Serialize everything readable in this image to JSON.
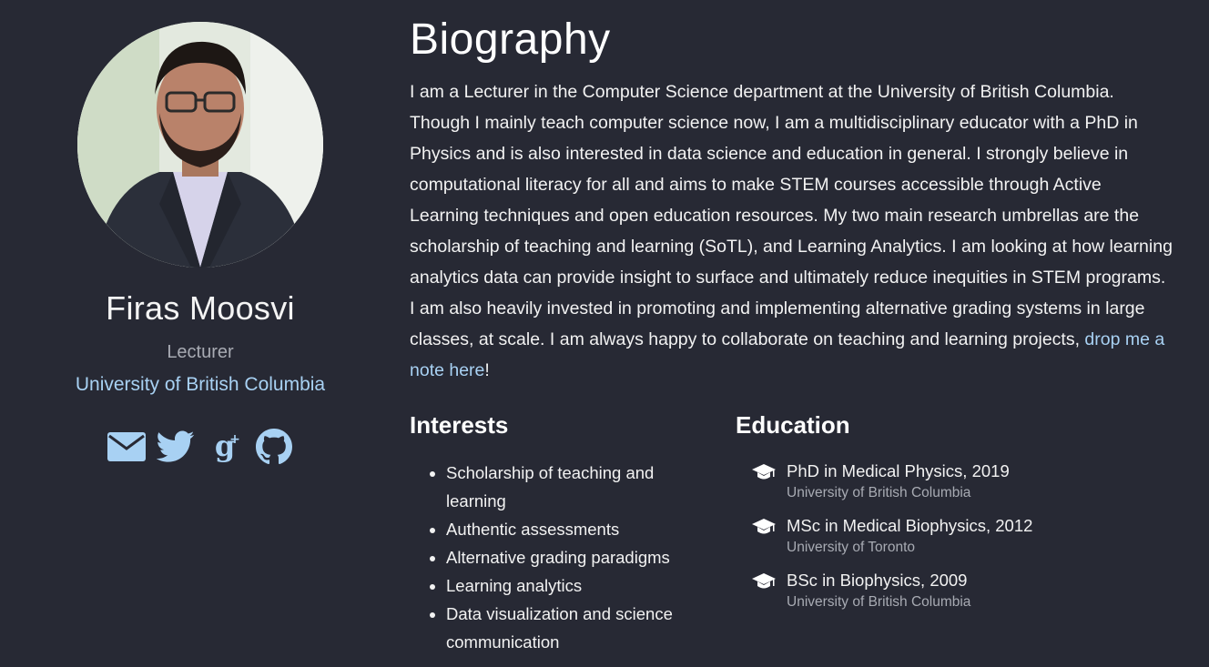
{
  "profile": {
    "name": "Firas Moosvi",
    "role": "Lecturer",
    "organization": "University of British Columbia",
    "social": [
      {
        "icon": "envelope-icon",
        "label": "Email"
      },
      {
        "icon": "twitter-icon",
        "label": "Twitter"
      },
      {
        "icon": "google-scholar-icon",
        "label": "Google Scholar"
      },
      {
        "icon": "github-icon",
        "label": "GitHub"
      }
    ]
  },
  "biography": {
    "title": "Biography",
    "text": "I am a Lecturer in the Computer Science department at the University of British Columbia. Though I mainly teach computer science now, I am a multidisciplinary educator with a PhD in Physics and is also interested in data science and education in general. I strongly believe in computational literacy for all and aims to make STEM courses accessible through Active Learning techniques and open education resources. My two main research umbrellas are the scholarship of teaching and learning (SoTL), and Learning Analytics. I am looking at how learning analytics data can provide insight to surface and ultimately reduce inequities in STEM programs. I am also heavily invested in promoting and implementing alternative grading systems in large classes, at scale. I am always happy to collaborate on teaching and learning projects, ",
    "link_text": "drop me a note here",
    "trailing": "!"
  },
  "interests": {
    "title": "Interests",
    "items": [
      "Scholarship of teaching and learning",
      "Authentic assessments",
      "Alternative grading paradigms",
      "Learning analytics",
      "Data visualization and science communication"
    ]
  },
  "education": {
    "title": "Education",
    "items": [
      {
        "degree": "PhD in Medical Physics, 2019",
        "institution": "University of British Columbia"
      },
      {
        "degree": "MSc in Medical Biophysics, 2012",
        "institution": "University of Toronto"
      },
      {
        "degree": "BSc in Biophysics, 2009",
        "institution": "University of British Columbia"
      }
    ]
  },
  "colors": {
    "background": "#272934",
    "link": "#a8d1f3",
    "muted": "#a8abb3"
  }
}
